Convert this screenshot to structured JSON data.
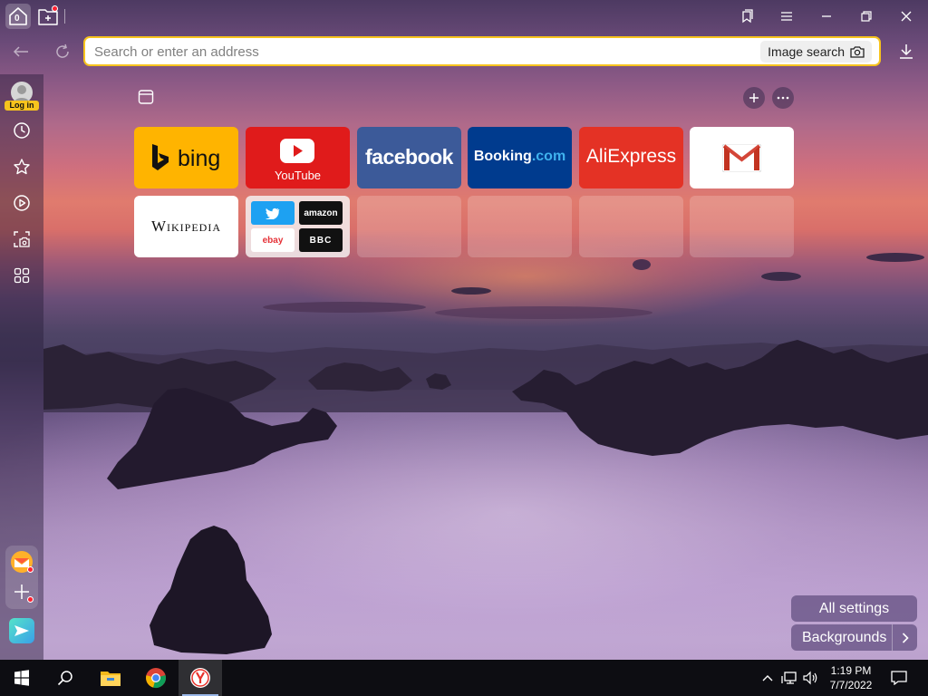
{
  "titlebar": {
    "tab_count": "0",
    "icons": [
      "home-tab-icon",
      "new-tab-folder-icon",
      "bookmarks-icon",
      "menu-icon",
      "minimize-icon",
      "restore-icon",
      "close-icon"
    ]
  },
  "addressbar": {
    "placeholder": "Search or enter an address",
    "image_search_label": "Image search"
  },
  "sidebar": {
    "login_label": "Log in",
    "items": [
      "history-icon",
      "favorites-star-icon",
      "video-play-icon",
      "screenshot-icon",
      "apps-grid-icon"
    ],
    "bottom": [
      "mail-icon",
      "add-icon",
      "messenger-icon"
    ]
  },
  "tiles": [
    {
      "name": "bing",
      "label": "bing",
      "bg": "#FFB400"
    },
    {
      "name": "youtube",
      "label": "YouTube",
      "bg": "#E01B1B"
    },
    {
      "name": "facebook",
      "label": "facebook",
      "bg": "#3C5A99"
    },
    {
      "name": "booking",
      "label": "Booking",
      "label_suffix": ".com",
      "bg": "#003B8E"
    },
    {
      "name": "aliexpress",
      "label": "AliExpress",
      "bg": "#E43225"
    },
    {
      "name": "gmail",
      "label": "",
      "bg": "#FFFFFF"
    },
    {
      "name": "wikipedia",
      "label": "Wikipedia",
      "bg": "#FFFFFF"
    },
    {
      "name": "folder",
      "items": [
        "",
        "amazon",
        "ebay",
        "BBC"
      ]
    },
    {
      "name": "empty"
    },
    {
      "name": "empty"
    },
    {
      "name": "empty"
    },
    {
      "name": "empty"
    }
  ],
  "actions": {
    "all_settings": "All settings",
    "backgrounds": "Backgrounds"
  },
  "taskbar": {
    "time": "1:19 PM",
    "date": "7/7/2022",
    "apps": [
      "windows-start-icon",
      "search-icon",
      "file-explorer-icon",
      "chrome-icon",
      "yandex-browser-icon"
    ]
  },
  "colors": {
    "accent": "#F7C31D",
    "notification": "#FF2030"
  }
}
